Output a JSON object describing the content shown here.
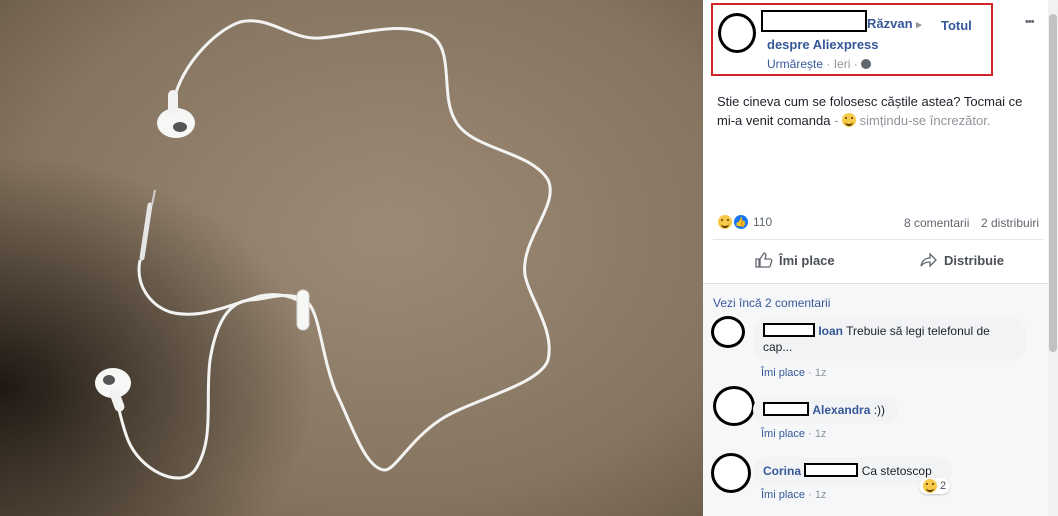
{
  "post": {
    "author_name": "Răzvan",
    "arrow": "▸",
    "group": "Totul despre Aliexpress",
    "follow": "Urmărește",
    "time": "Ieri",
    "sep": "·",
    "text": "Stie cineva cum se folosesc căștile astea? Tocmai ce mi-a venit comanda",
    "dash": "-",
    "feeling": "simțindu-se încrezător.",
    "more": "•••"
  },
  "stats": {
    "reactions": "110",
    "comments": "8 comentarii",
    "shares": "2 distribuiri"
  },
  "actions": {
    "like": "Îmi place",
    "share": "Distribuie"
  },
  "comments": {
    "more_link": "Vezi încă 2 comentarii",
    "items": [
      {
        "name": "Ioan",
        "text": "Trebuie să legi telefonul de cap...",
        "like": "Îmi place",
        "time": "1z"
      },
      {
        "name": "Alexandra",
        "text": ":))",
        "like": "Îmi place",
        "time": "1z"
      },
      {
        "name": "Corina",
        "text": "Ca stetoscop",
        "like": "Îmi place",
        "time": "1z",
        "reactions": "2"
      }
    ]
  },
  "colors": {
    "link": "#365899",
    "highlight": "#d0242b",
    "muted": "#90949c"
  }
}
